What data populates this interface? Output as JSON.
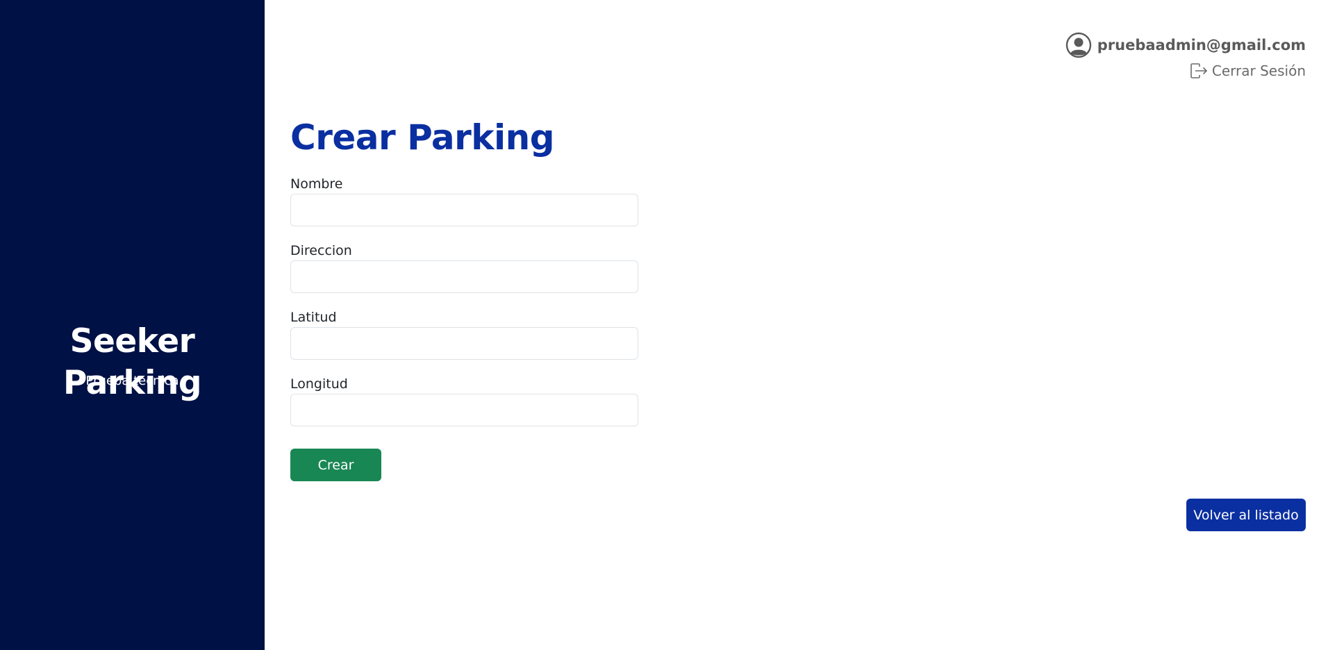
{
  "sidebar": {
    "brand": "Seeker Parking",
    "tagline": "Prueba tecnica",
    "background": "#001145"
  },
  "user": {
    "icon": "user-circle-icon",
    "email": "pruebaadmin@gmail.com",
    "logout_icon": "logout-icon",
    "logout_label": "Cerrar Sesión"
  },
  "form": {
    "title": "Crear Parking",
    "fields": [
      {
        "label": "Nombre",
        "value": ""
      },
      {
        "label": "Direccion",
        "value": ""
      },
      {
        "label": "Latitud",
        "value": ""
      },
      {
        "label": "Longitud",
        "value": ""
      }
    ],
    "submit_label": "Crear"
  },
  "actions": {
    "back_label": "Volver al listado"
  },
  "colors": {
    "title": "#0a2fa1",
    "submit_button": "#198754",
    "back_button": "#0a2fa1"
  }
}
